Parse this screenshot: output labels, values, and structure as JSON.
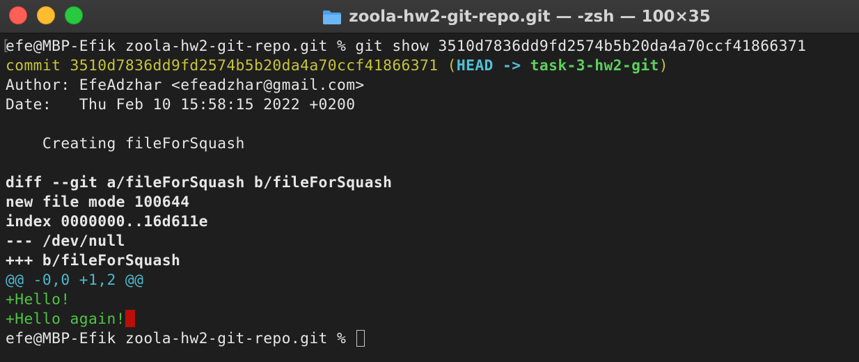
{
  "window": {
    "title": "zoola-hw2-git-repo.git — -zsh — 100×35",
    "folder_icon": "folder-icon",
    "colors": {
      "background": "#1e1e1e",
      "close": "#ff5f57",
      "minimize": "#febc2e",
      "maximize": "#28c840"
    }
  },
  "terminal": {
    "prompt_command": "efe@MBP-Efik zoola-hw2-git-repo.git % git show 3510d7836dd9fd2574b5b20da4a70ccf41866371",
    "commit_label": "commit 3510d7836dd9fd2574b5b20da4a70ccf41866371",
    "ref_open": " (",
    "head": "HEAD",
    "arrow": " -> ",
    "branch": "task-3-hw2-git",
    "ref_close": ")",
    "author": "Author: EfeAdzhar <efeadzhar@gmail.com>",
    "date": "Date:   Thu Feb 10 15:58:15 2022 +0200",
    "message": "    Creating fileForSquash",
    "diff_header": "diff --git a/fileForSquash b/fileForSquash",
    "new_file_mode": "new file mode 100644",
    "index": "index 0000000..16d611e",
    "minus_file": "--- /dev/null",
    "plus_file": "+++ b/fileForSquash",
    "hunk": "@@ -0,0 +1,2 @@",
    "added_1": "+Hello!",
    "added_2": "+Hello again!",
    "final_prompt": "efe@MBP-Efik zoola-hw2-git-repo.git % "
  }
}
